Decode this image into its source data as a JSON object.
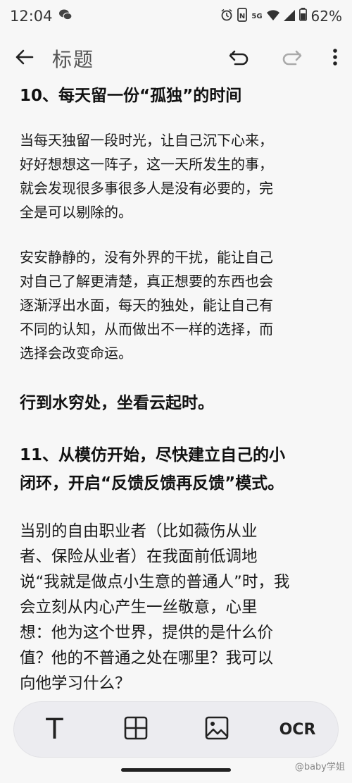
{
  "status_bar": {
    "time": "12:04",
    "battery": "62%",
    "network_tag": "5G",
    "icons": [
      "wechat-icon",
      "alarm-icon",
      "nfc-icon",
      "wifi-icon",
      "signal-icon",
      "battery-icon"
    ]
  },
  "toolbar": {
    "title": "标题",
    "icons": [
      "back-arrow-icon",
      "undo-icon",
      "redo-icon",
      "more-vert-icon"
    ]
  },
  "content": {
    "heading_10": "10、每天留一份“孤独”的时间",
    "p1": [
      "当每天独留一段时光，让自己沉下心来，",
      "好好想想这一阵子，这一天所发生的事，",
      "就会发现很多事很多人是没有必要的，完",
      "全是可以剔除的。"
    ],
    "p2": [
      "安安静静的，没有外界的干扰，能让自己",
      "对自己了解更清楚，真正想要的东西也会",
      "逐渐浮出水面，每天的独处，能让自己有",
      "不同的认知，从而做出不一样的选择，而",
      "选择会改变命运。"
    ],
    "heading_quote": "行到水穷处，坐看云起时。",
    "heading_11": [
      "11、从模仿开始，尽快建立自己的小",
      "闭环，开启“反馈反馈再反馈”模式。"
    ],
    "p3": [
      "当别的自由职业者（比如薇伤从业",
      "者、保险从业者）在我面前低调地",
      "说“我就是做点小生意的普通人”时，我",
      "会立刻从内心产生一丝敬意，心里",
      "想：他为这个世界，提供的是什么价",
      "值？他的不普通之处在哪里？我可以",
      "向他学习什么？"
    ]
  },
  "bottom_bar": {
    "text_label": "T",
    "ocr_label": "OCR",
    "icons": [
      "text-format-icon",
      "table-icon",
      "image-icon"
    ]
  },
  "watermark": "@baby学姐"
}
